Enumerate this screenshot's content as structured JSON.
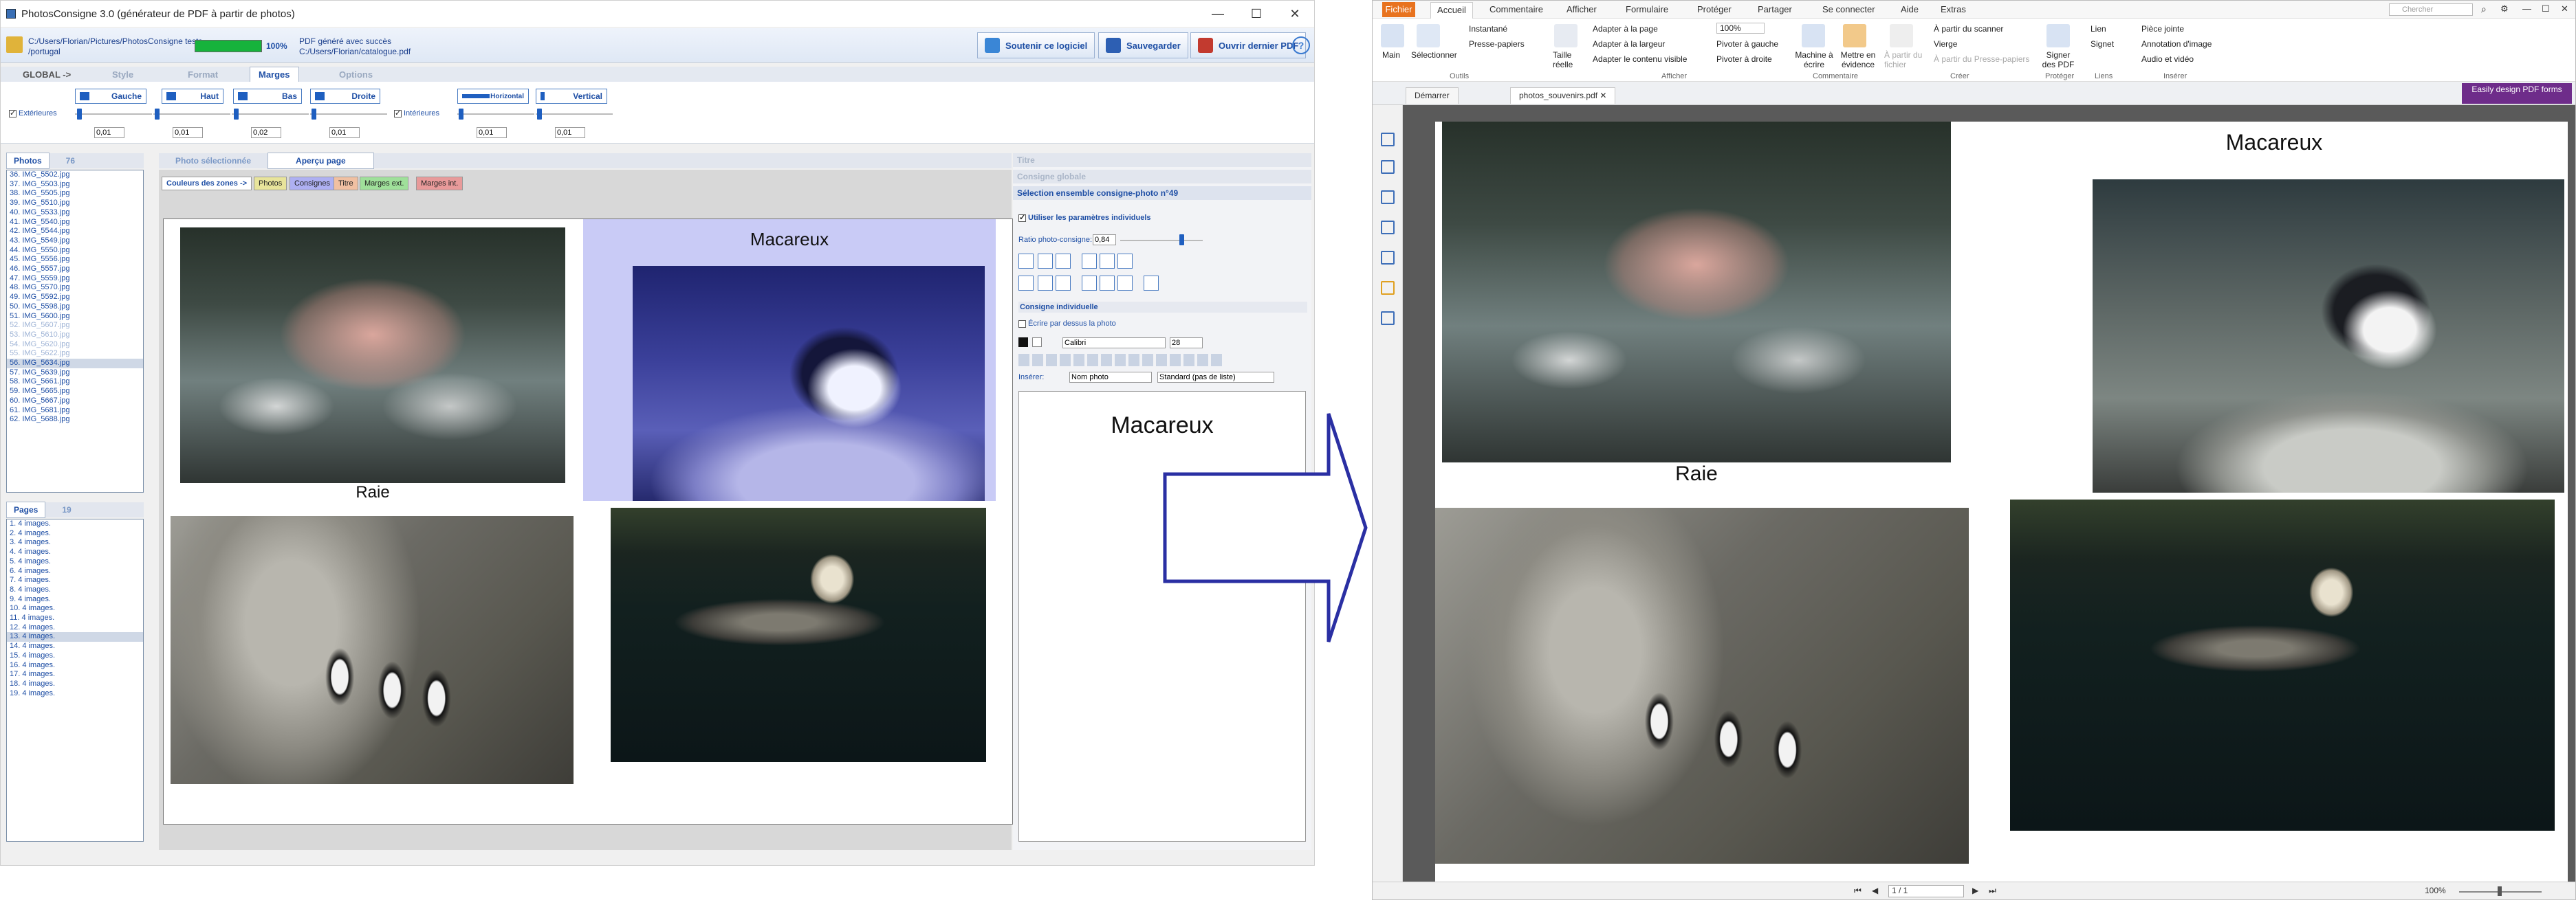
{
  "left": {
    "title": "PhotosConsigne 3.0 (générateur de PDF à partir de photos)",
    "path1": "C:/Users/Florian/Pictures/PhotosConsigne tests",
    "path2": "/portugal",
    "progress_pct": "100%",
    "status1": "PDF généré avec succès",
    "status2": "C:/Users/Florian/catalogue.pdf",
    "btn_support": "Soutenir ce logiciel",
    "btn_save": "Sauvegarder",
    "btn_open": "Ouvrir dernier PDF",
    "tabs": [
      "GLOBAL ->",
      "Style",
      "Format",
      "Marges",
      "Options"
    ],
    "margins": {
      "exterieures": "Extérieures",
      "gauche": "Gauche",
      "haut": "Haut",
      "bas": "Bas",
      "droite": "Droite",
      "interieures": "Intérieures",
      "horizontal": "Horizontal",
      "vertical": "Vertical",
      "v_gauche": "0,01",
      "v_haut": "0,01",
      "v_bas": "0,02",
      "v_droite": "0,01",
      "v_horiz": "0,01",
      "v_vert": "0,01"
    },
    "photos_tab": "Photos",
    "photos_count": "76",
    "photos": [
      "36. IMG_5502.jpg",
      "37. IMG_5503.jpg",
      "38. IMG_5505.jpg",
      "39. IMG_5510.jpg",
      "40. IMG_5533.jpg",
      "41. IMG_5540.jpg",
      "42. IMG_5544.jpg",
      "43. IMG_5549.jpg",
      "44. IMG_5550.jpg",
      "45. IMG_5556.jpg",
      "46. IMG_5557.jpg",
      "47. IMG_5559.jpg",
      "48. IMG_5570.jpg",
      "49. IMG_5592.jpg",
      "50. IMG_5598.jpg",
      "51. IMG_5600.jpg",
      "52. IMG_5607.jpg",
      "53. IMG_5610.jpg",
      "54. IMG_5620.jpg",
      "55. IMG_5622.jpg",
      "56. IMG_5634.jpg",
      "57. IMG_5639.jpg",
      "58. IMG_5661.jpg",
      "59. IMG_5665.jpg",
      "60. IMG_5667.jpg",
      "61. IMG_5681.jpg",
      "62. IMG_5688.jpg"
    ],
    "pages_tab": "Pages",
    "pages_count": "19",
    "pages": [
      "1. 4 images.",
      "2. 4 images.",
      "3. 4 images.",
      "4. 4 images.",
      "5. 4 images.",
      "6. 4 images.",
      "7. 4 images.",
      "8. 4 images.",
      "9. 4 images.",
      "10. 4 images.",
      "11. 4 images.",
      "12. 4 images.",
      "13. 4 images.",
      "14. 4 images.",
      "15. 4 images.",
      "16. 4 images.",
      "17. 4 images.",
      "18. 4 images.",
      "19. 4 images."
    ],
    "view_tab1": "Photo sélectionnée",
    "view_tab2": "Aperçu page",
    "zones_label": "Couleurs des zones ->",
    "chips": [
      "Photos",
      "Consignes",
      "Titre",
      "Marges ext.",
      "Marges int."
    ],
    "caption_raie": "Raie",
    "caption_macareux": "Macareux",
    "rp_titre": "Titre",
    "rp_global": "Consigne globale",
    "rp_selection": "Sélection ensemble consigne-photo n°49",
    "rp_use_params": "Utiliser les paramètres individuels",
    "rp_ratio": "Ratio photo-consigne:",
    "rp_ratio_val": "0,84",
    "rp_indiv": "Consigne individuelle",
    "rp_write_over": "Écrire par dessus la photo",
    "rp_font": "Calibri",
    "rp_size": "28",
    "rp_insert": "Insérer:",
    "rp_insert_sel": "Nom photo",
    "rp_list_sel": "Standard (pas de liste)",
    "rp_text": "Macareux"
  },
  "right": {
    "menu": [
      "Fichier",
      "Accueil",
      "Commentaire",
      "Afficher",
      "Formulaire",
      "Protéger",
      "Partager",
      "Se connecter",
      "Aide",
      "Extras"
    ],
    "search_placeholder": "Chercher",
    "ribbon": {
      "main": "Main",
      "select": "Sélectionner",
      "snapshot": "Instantané",
      "clipboard": "Presse-papiers",
      "actual": "Taille réelle",
      "fit_page": "Adapter à la page",
      "fit_width": "Adapter à la largeur",
      "fit_visible": "Adapter le contenu visible",
      "zoom": "100%",
      "rotate_left": "Pivoter à gauche",
      "rotate_right": "Pivoter à droite",
      "typewriter": "Machine à écrire",
      "highlight": "Mettre en évidence",
      "from_file": "À partir du fichier",
      "from_scanner": "À partir du scanner",
      "blank": "Vierge",
      "from_clipboard": "À partir du Presse-papiers",
      "sign": "Signer des PDF",
      "link": "Lien",
      "bookmark": "Signet",
      "attachment": "Pièce jointe",
      "image_annot": "Annotation d'image",
      "audio_video": "Audio et vidéo",
      "g_outils": "Outils",
      "g_afficher": "Afficher",
      "g_commentaire": "Commentaire",
      "g_creer": "Créer",
      "g_proteger": "Protéger",
      "g_liens": "Liens",
      "g_inserer": "Insérer",
      "promo": "Easily design PDF forms"
    },
    "tab_start": "Démarrer",
    "tab_doc": "photos_souvenirs.pdf",
    "caption_raie": "Raie",
    "caption_macareux": "Macareux",
    "page_nav": "1 / 1",
    "zoom_status": "100%"
  },
  "colors": {
    "accent": "#1f4fa5",
    "progress": "#16b33c",
    "arrow": "#2a2fa3",
    "fichier": "#e8731f"
  }
}
